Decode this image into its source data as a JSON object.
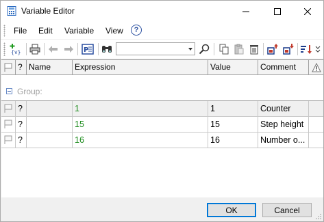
{
  "window": {
    "title": "Variable Editor"
  },
  "menu": {
    "file": "File",
    "edit": "Edit",
    "variable": "Variable",
    "view": "View",
    "help": "?"
  },
  "toolbar": {
    "icons": [
      "add-variable-icon",
      "print-icon",
      "undo-icon",
      "redo-icon",
      "properties-icon",
      "find-icon",
      "search-icon",
      "copy-icon",
      "paste-icon",
      "delete-icon",
      "move-up-icon",
      "move-down-icon",
      "sort-icon"
    ],
    "search_value": ""
  },
  "grid": {
    "headers": {
      "flag": "",
      "q": "?",
      "name": "Name",
      "expression": "Expression",
      "value": "Value",
      "comment": "Comment"
    },
    "group_label": "Group:",
    "rows": [
      {
        "q": "?",
        "name": "",
        "expression": "1",
        "value": "1",
        "comment": "Counter"
      },
      {
        "q": "?",
        "name": "",
        "expression": "15",
        "value": "15",
        "comment": "Step height"
      },
      {
        "q": "?",
        "name": "",
        "expression": "16",
        "value": "16",
        "comment": "Number o..."
      }
    ]
  },
  "buttons": {
    "ok": "OK",
    "cancel": "Cancel"
  },
  "colors": {
    "expression_text": "#1e8c1e",
    "accent": "#0078d7"
  }
}
